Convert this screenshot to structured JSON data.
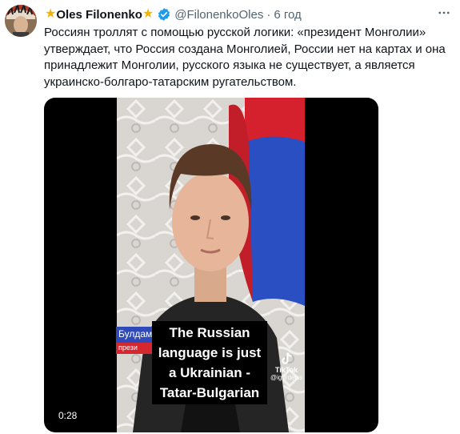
{
  "author": {
    "display_name": "Oles Filonenko",
    "star_left": "★",
    "star_right": "★",
    "verified_icon": "verified-badge-icon",
    "handle": "@FilonenkoOles",
    "separator": "·",
    "time": "6 год"
  },
  "tweet": {
    "text": "Россиян троллят с помощью русской логики: «президент Монголии» утверждает, что Россия создана Монголией, России нет на картах и она принадлежит Монголии, русского языка не существует, а является украинско-болгаро-татарским ругательством."
  },
  "media": {
    "caption": "The Russian language is just a Ukrainian -Tatar-Bulgarian",
    "name_strip_line1": "Булдам",
    "name_strip_line2": "прези",
    "watermark_label": "TikTok",
    "watermark_user": "@igordeiss",
    "duration": "0:28"
  },
  "colors": {
    "accent": "#1d9bf0",
    "text": "#0f1419",
    "secondary": "#536471",
    "star": "#f5b301"
  }
}
